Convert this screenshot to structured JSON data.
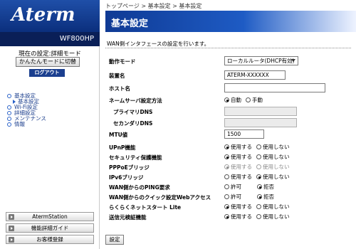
{
  "sidebar": {
    "logo": "Aterm",
    "model": "WF800HP",
    "mode_label": "現在の設定:詳細モード",
    "easy_mode_button": "かんたんモードに切替",
    "logout_button": "ログアウト",
    "nav": [
      {
        "label": "基本設定",
        "children": [
          {
            "label": "基本設定"
          }
        ]
      },
      {
        "label": "Wi-Fi設定"
      },
      {
        "label": "詳細設定"
      },
      {
        "label": "メンテナンス"
      },
      {
        "label": "情報"
      }
    ],
    "bottom_buttons": [
      {
        "label": "AtermStation"
      },
      {
        "label": "機能詳細ガイド"
      },
      {
        "label": "お客様登録"
      }
    ]
  },
  "breadcrumb": "トップページ > 基本設定 > 基本設定",
  "page_title": "基本設定",
  "description": "WAN側インタフェースの設定を行います。",
  "form": {
    "operation_mode": {
      "label": "動作モード",
      "value": "ローカルルータ(DHCP有効)"
    },
    "device_name": {
      "label": "装置名",
      "value": "ATERM-XXXXXX"
    },
    "host_name": {
      "label": "ホスト名",
      "value": ""
    },
    "dns_method": {
      "label": "ネームサーバ設定方法",
      "options": [
        "自動",
        "手動"
      ],
      "selected": "自動"
    },
    "primary_dns": {
      "label": "プライマリDNS",
      "value": ""
    },
    "secondary_dns": {
      "label": "セカンダリDNS",
      "value": ""
    },
    "mtu": {
      "label": "MTU値",
      "value": "1500"
    },
    "upnp": {
      "label": "UPnP機能",
      "options": [
        "使用する",
        "使用しない"
      ],
      "selected": "使用する"
    },
    "security": {
      "label": "セキュリティ保護機能",
      "options": [
        "使用する",
        "使用しない"
      ],
      "selected": "使用する"
    },
    "pppoe_bridge": {
      "label": "PPPoEブリッジ",
      "options": [
        "使用する",
        "使用しない"
      ],
      "selected": "使用する"
    },
    "ipv6_bridge": {
      "label": "IPv6ブリッジ",
      "options": [
        "使用する",
        "使用しない"
      ],
      "selected": "使用しない"
    },
    "wan_ping": {
      "label": "WAN側からのPING要求",
      "options": [
        "許可",
        "拒否"
      ],
      "selected": "拒否"
    },
    "wan_quick_web": {
      "label": "WAN側からのクイック設定Webアクセス",
      "options": [
        "許可",
        "拒否"
      ],
      "selected": "拒否"
    },
    "rakuraku_net": {
      "label": "らくらくネットスタート Lite",
      "options": [
        "使用する",
        "使用しない"
      ],
      "selected": "使用する"
    },
    "source_check": {
      "label": "送信元検証機能",
      "options": [
        "使用する",
        "使用しない"
      ],
      "selected": "使用する"
    }
  },
  "submit_button": "設定"
}
